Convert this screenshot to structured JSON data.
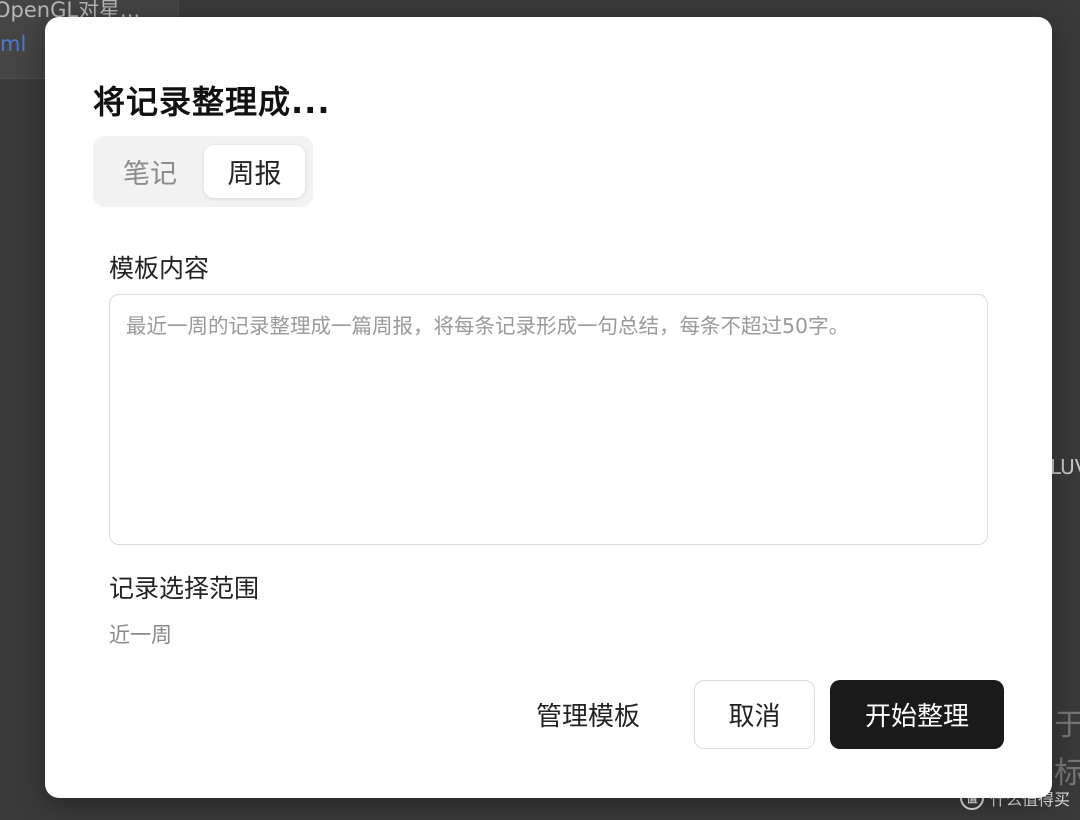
{
  "background": {
    "left_line1": "OpenGL对星...",
    "left_line2": "ml",
    "right_text1": "LUV",
    "right_text2": "于",
    "right_text3": "标"
  },
  "watermark": {
    "logo": "值",
    "text": "什么值得买"
  },
  "dialog": {
    "title": "将记录整理成...",
    "tabs": [
      {
        "label": "笔记",
        "selected": false
      },
      {
        "label": "周报",
        "selected": true
      }
    ],
    "template": {
      "label": "模板内容",
      "value": "",
      "placeholder": "最近一周的记录整理成一篇周报，将每条记录形成一句总结，每条不超过50字。"
    },
    "range": {
      "label": "记录选择范围",
      "value": "近一周"
    },
    "buttons": {
      "manage": "管理模板",
      "cancel": "取消",
      "start": "开始整理"
    }
  },
  "colors": {
    "primary_button": "#1a1a1a",
    "overlay": "#3a3a3a",
    "dialog_bg": "#ffffff"
  }
}
